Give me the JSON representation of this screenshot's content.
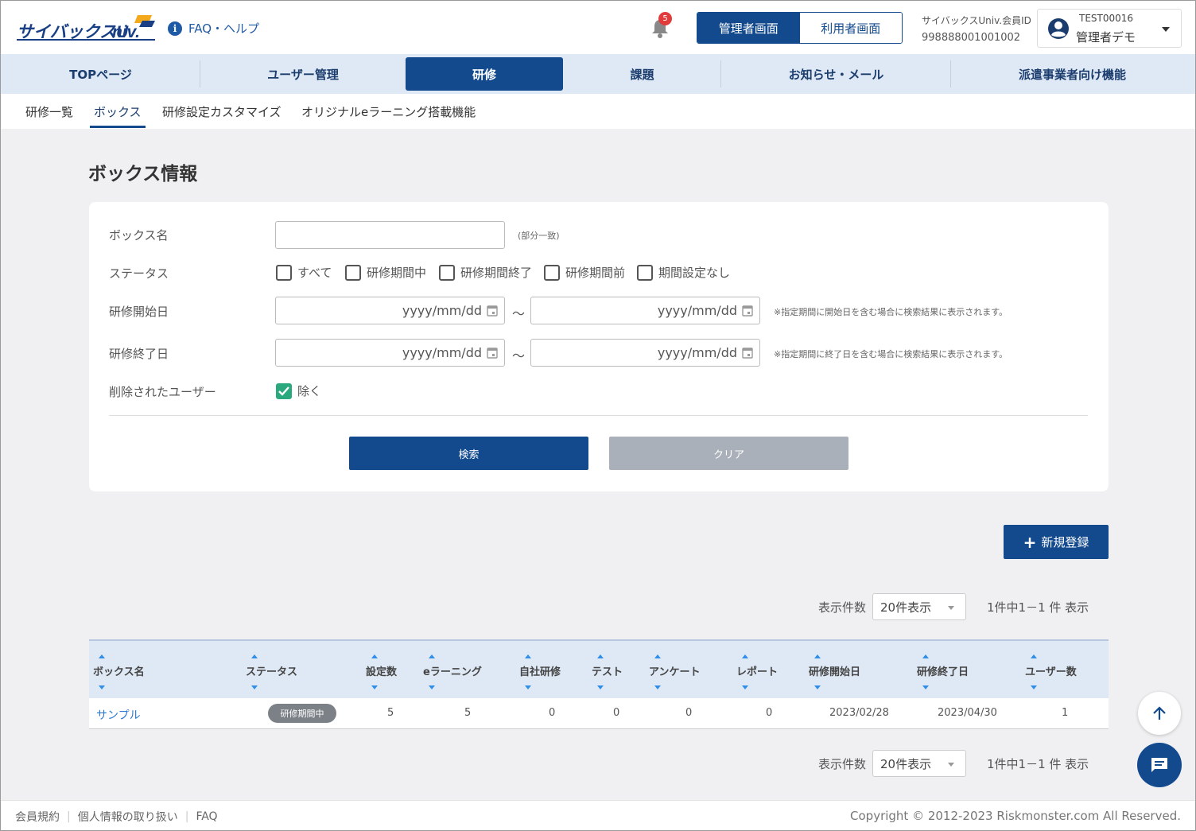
{
  "header": {
    "logo_text": "サイバックスUniv.",
    "faq_label": "FAQ・ヘルプ",
    "notification_count": "5",
    "mode_admin": "管理者画面",
    "mode_user": "利用者画面",
    "member_id_label": "サイバックスUniv.会員ID",
    "member_id": "998888001001002",
    "account_id": "TEST00016",
    "account_name": "管理者デモ"
  },
  "nav": {
    "items": [
      {
        "label": "TOPページ"
      },
      {
        "label": "ユーザー管理"
      },
      {
        "label": "研修"
      },
      {
        "label": "課題"
      },
      {
        "label": "お知らせ・メール"
      },
      {
        "label": "派遣事業者向け機能"
      }
    ],
    "active": "研修"
  },
  "subnav": {
    "items": [
      {
        "label": "研修一覧"
      },
      {
        "label": "ボックス"
      },
      {
        "label": "研修設定カスタマイズ"
      },
      {
        "label": "オリジナルeラーニング搭載機能"
      }
    ],
    "active": "ボックス"
  },
  "page_title": "ボックス情報",
  "search": {
    "box_name_label": "ボックス名",
    "box_name_value": "",
    "box_name_hint": "(部分一致)",
    "status_label": "ステータス",
    "status_options": [
      {
        "label": "すべて",
        "checked": false
      },
      {
        "label": "研修期間中",
        "checked": false
      },
      {
        "label": "研修期間終了",
        "checked": false
      },
      {
        "label": "研修期間前",
        "checked": false
      },
      {
        "label": "期間設定なし",
        "checked": false
      }
    ],
    "start_label": "研修開始日",
    "end_label": "研修終了日",
    "date_placeholder": "yyyy/mm/dd",
    "range_sep": "～",
    "start_hint": "※指定期間に開始日を含む場合に検索結果に表示されます。",
    "end_hint": "※指定期間に終了日を含む場合に検索結果に表示されます。",
    "deleted_label": "削除されたユーザー",
    "deleted_option": "除く",
    "deleted_checked": true,
    "search_button": "検索",
    "clear_button": "クリア"
  },
  "new_button": "新規登録",
  "pager": {
    "count_label": "表示件数",
    "select_value": "20件表示",
    "summary": "1件中1－1 件 表示"
  },
  "table": {
    "columns": [
      "ボックス名",
      "ステータス",
      "設定数",
      "eラーニング",
      "自社研修",
      "テスト",
      "アンケート",
      "レポート",
      "研修開始日",
      "研修終了日",
      "ユーザー数"
    ],
    "rows": [
      {
        "name": "サンプル",
        "status": "研修期間中",
        "settings": "5",
        "elearning": "5",
        "inhouse": "0",
        "test": "0",
        "survey": "0",
        "report": "0",
        "start": "2023/02/28",
        "end": "2023/04/30",
        "users": "1"
      }
    ]
  },
  "footer": {
    "links": [
      "会員規約",
      "個人情報の取り扱い",
      "FAQ"
    ],
    "copyright": "Copyright © 2012-2023 Riskmonster.com All Reserved."
  },
  "colors": {
    "primary": "#134a8e",
    "nav_bg": "#dfe9f5",
    "check": "#2aa87e",
    "badge": "#e23b3b"
  }
}
